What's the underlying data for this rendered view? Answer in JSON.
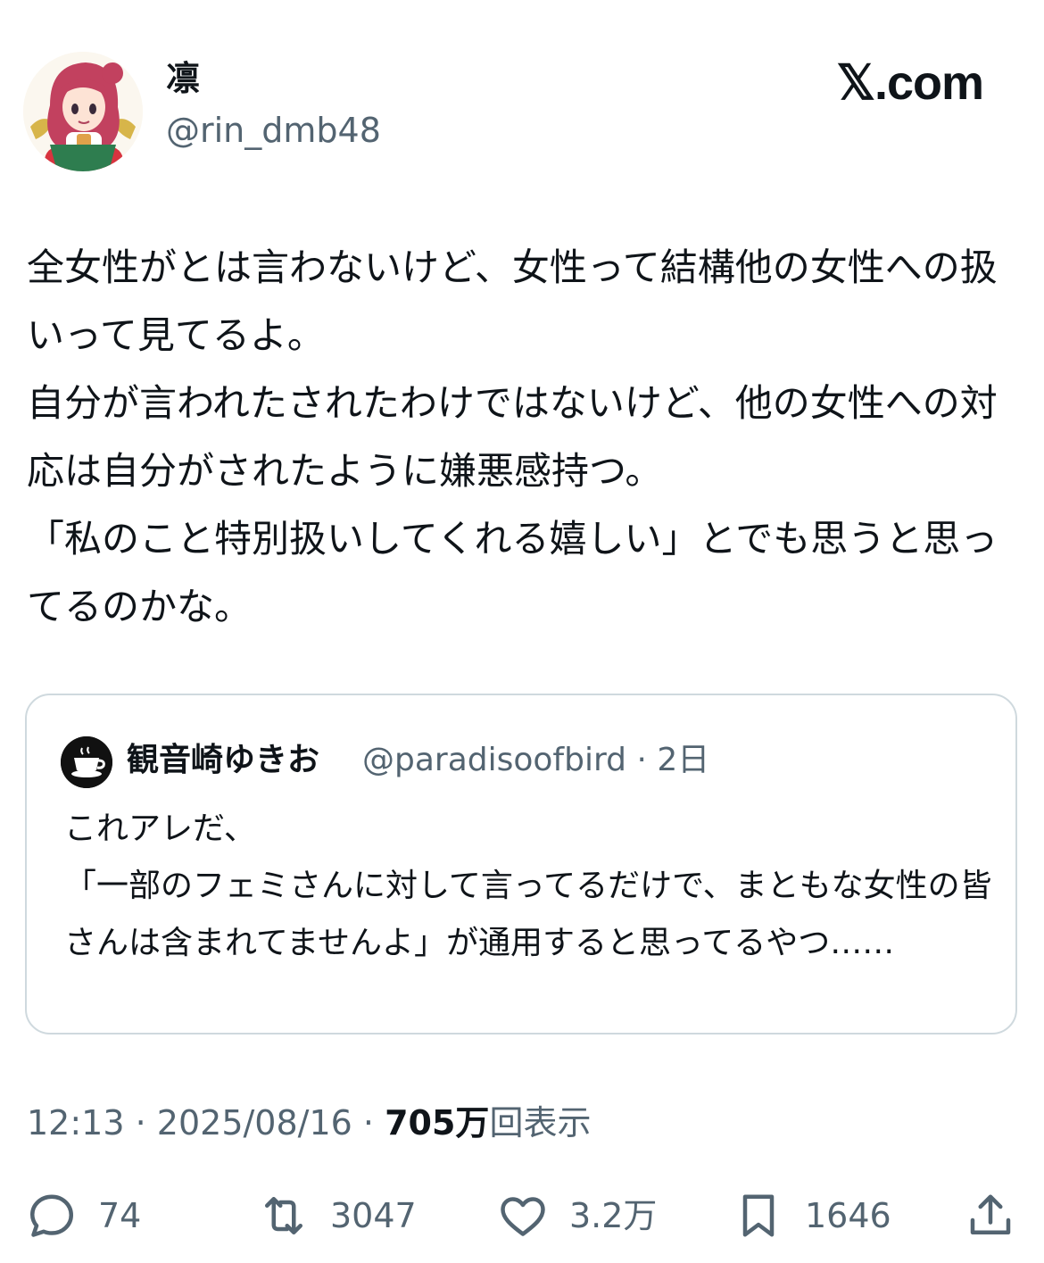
{
  "author": {
    "display_name": "凛",
    "handle": "@rin_dmb48",
    "avatar_icon": "anime-character-avatar"
  },
  "brand": {
    "watermark": "𝕏.com"
  },
  "tweet": {
    "text": "全女性がとは言わないけど、女性って結構他の女性への扱いって見てるよ。\n自分が言われたされたわけではないけど、他の女性への対応は自分がされたように嫌悪感持つ。\n「私のこと特別扱いしてくれる嬉しい」とでも思うと思ってるのかな。"
  },
  "quoted_tweet": {
    "avatar_icon": "coffee-cup-avatar",
    "display_name": "観音崎ゆきお",
    "handle": "@paradisoofbird",
    "separator": "·",
    "age": "2日",
    "text": "これアレだ、\n「一部のフェミさんに対して言ってるだけで、まともな女性の皆さんは含まれてませんよ」が通用すると思ってるやつ……"
  },
  "meta": {
    "time": "12:13",
    "date": "2025/08/16",
    "separator": "·",
    "views_count": "705万",
    "views_label": "回表示"
  },
  "actions": {
    "replies": {
      "icon": "reply-bubble-icon",
      "count": "74"
    },
    "reposts": {
      "icon": "repost-arrows-icon",
      "count": "3047"
    },
    "likes": {
      "icon": "heart-icon",
      "count": "3.2万"
    },
    "bookmarks": {
      "icon": "bookmark-icon",
      "count": "1646"
    },
    "share": {
      "icon": "share-upload-icon"
    }
  },
  "colors": {
    "text": "#0f1419",
    "secondary": "#536471",
    "border": "#cfd9de",
    "background": "#ffffff"
  }
}
